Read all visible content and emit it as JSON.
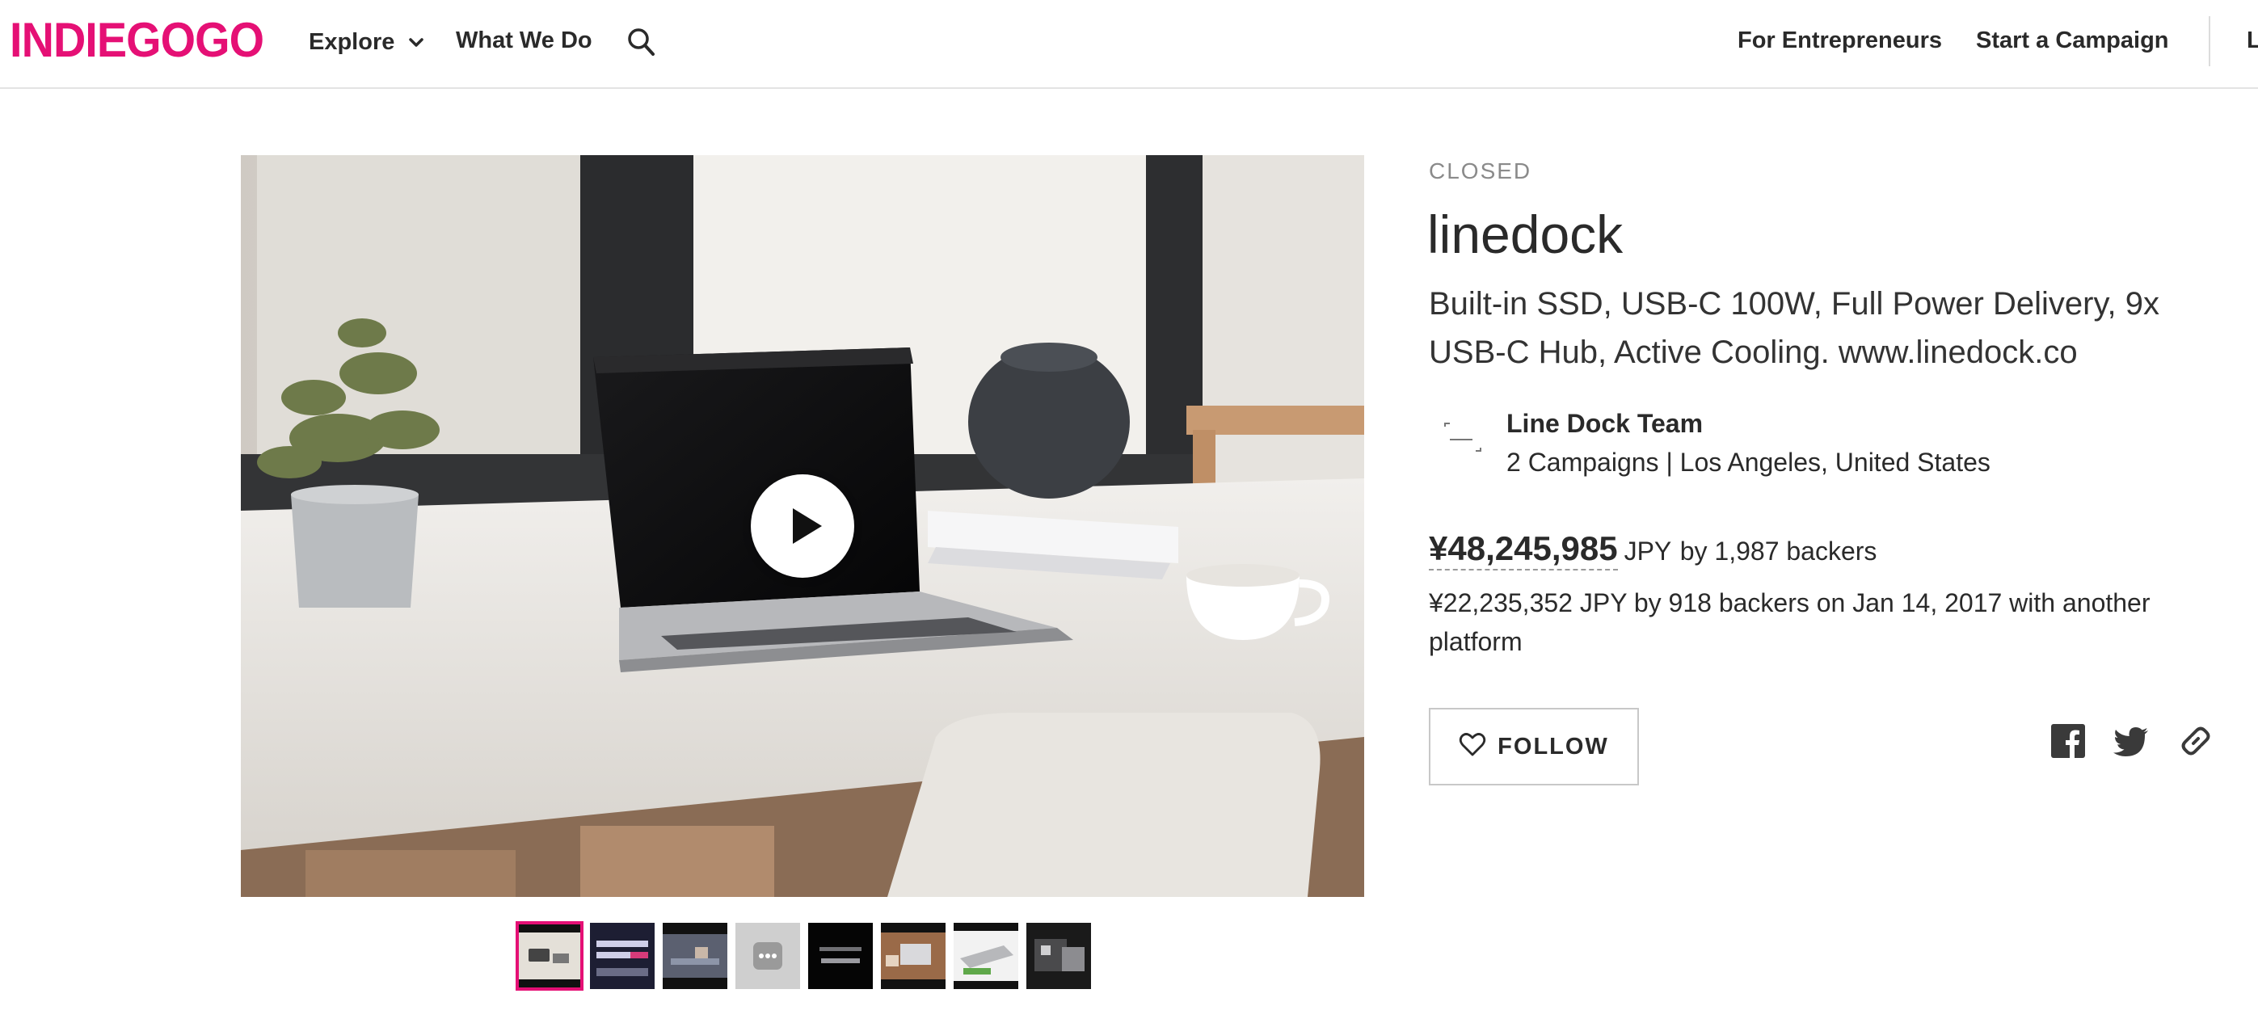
{
  "header": {
    "logo": "INDIEGOGO",
    "nav": {
      "explore": "Explore",
      "what_we_do": "What We Do",
      "for_entrepreneurs": "For Entrepreneurs",
      "start_campaign": "Start a Campaign",
      "cut_off": "L"
    },
    "icons": {
      "explore_chevron": "chevron-down-icon",
      "search": "search-icon"
    }
  },
  "campaign": {
    "status": "CLOSED",
    "title": "linedock",
    "tagline": "Built-in SSD, USB-C 100W, Full Power Delivery, 9x USB-C Hub, Active Cooling. www.linedock.co",
    "owner": {
      "name": "Line Dock Team",
      "meta": "2 Campaigns | Los Angeles, United States"
    },
    "funding": {
      "amount": "¥48,245,985",
      "currency": "JPY",
      "backers": "by 1,987 backers",
      "previous": "¥22,235,352 JPY by 918 backers on Jan 14, 2017 with another platform"
    },
    "follow_label": "FOLLOW",
    "share": [
      "facebook-icon",
      "twitter-icon",
      "link-icon"
    ]
  },
  "media": {
    "play_icon": "play-icon",
    "thumbnail_count": 8,
    "active_thumbnail": 1
  },
  "colors": {
    "brand": "#e51075",
    "text": "#2a2a2a",
    "muted": "#8a8a8a",
    "border": "#c8c8c8"
  }
}
